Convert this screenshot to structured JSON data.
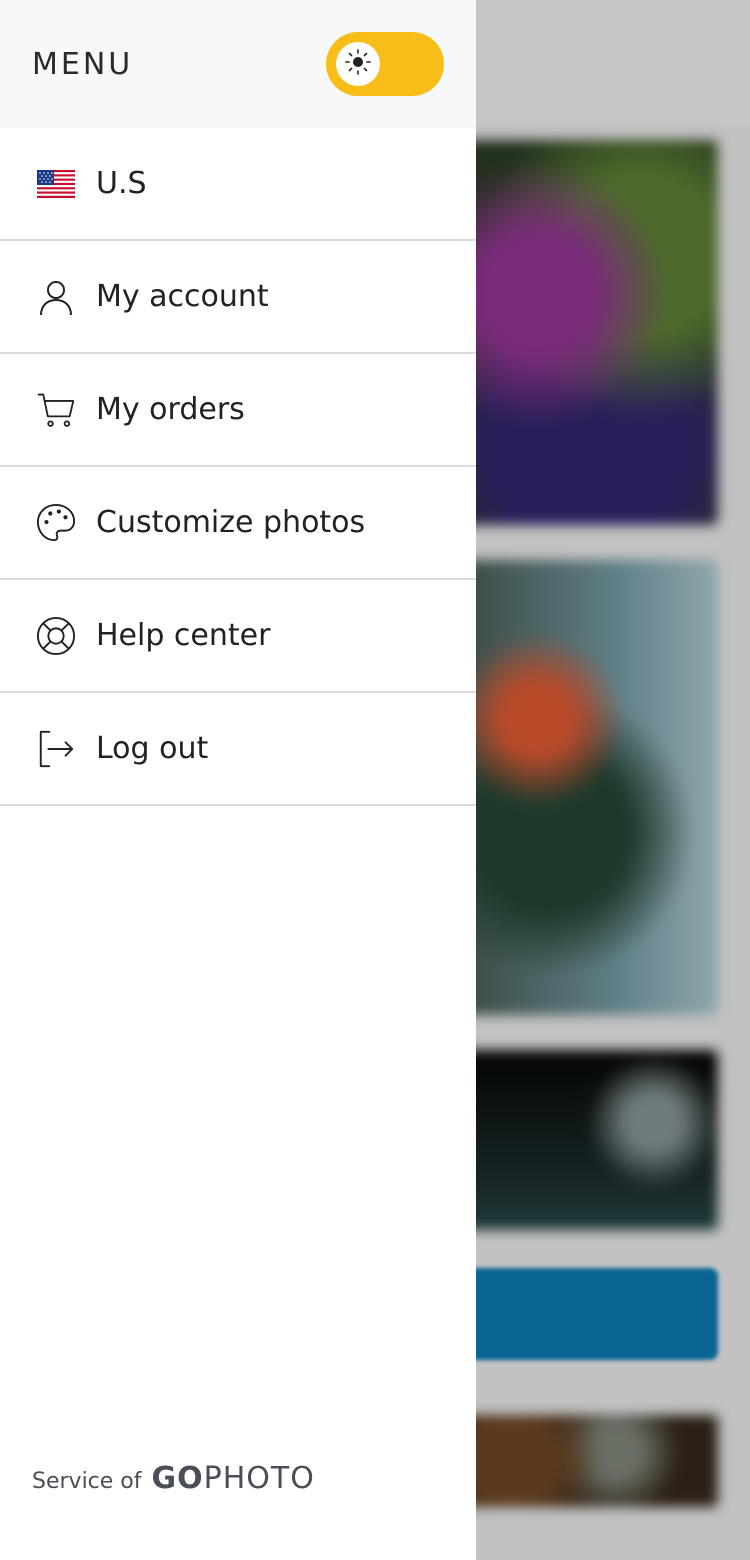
{
  "drawer": {
    "title": "MENU",
    "theme_toggle": {
      "state": "light",
      "color": "#f8bd16"
    },
    "items": [
      {
        "label": "U.S",
        "icon": "us-flag-icon"
      },
      {
        "label": "My account",
        "icon": "user-icon"
      },
      {
        "label": "My orders",
        "icon": "cart-icon"
      },
      {
        "label": "Customize photos",
        "icon": "palette-icon"
      },
      {
        "label": "Help center",
        "icon": "lifebuoy-icon"
      },
      {
        "label": "Log out",
        "icon": "logout-icon"
      }
    ],
    "footer": {
      "text": "Service of",
      "brand_bold": "GO",
      "brand_light": "PHOTO"
    }
  },
  "colors": {
    "accent_yellow": "#f8bd16",
    "cta_blue": "#0a6594",
    "divider": "#dcdcdc"
  }
}
